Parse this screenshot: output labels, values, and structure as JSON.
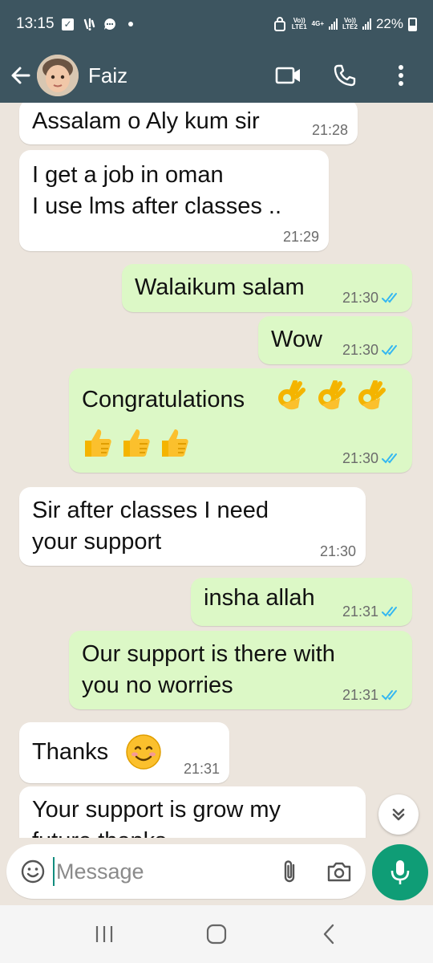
{
  "status": {
    "time": "13:15",
    "battery": "22%",
    "sim1_label": "Vo)) LTE1",
    "sim2_label": "Vo)) LTE2",
    "net": "4G+"
  },
  "header": {
    "contact_name": "Faiz",
    "icons": [
      "back-arrow-icon",
      "video-call-icon",
      "phone-icon",
      "more-icon"
    ]
  },
  "messages": [
    {
      "dir": "in",
      "text": "Assalam o Aly kum sir",
      "time": "21:28"
    },
    {
      "dir": "in",
      "text": "I get a job in oman\nI use lms after classes ..",
      "time": "21:29"
    },
    {
      "dir": "out",
      "text": "Walaikum salam",
      "time": "21:30",
      "read": true
    },
    {
      "dir": "out",
      "text": "Wow",
      "time": "21:30",
      "read": true
    },
    {
      "dir": "out",
      "text": "Congratulations",
      "time": "21:30",
      "read": true,
      "emojis_line1": [
        "ok-hand",
        "ok-hand",
        "ok-hand"
      ],
      "emojis_line2": [
        "thumbs-up",
        "thumbs-up",
        "thumbs-up"
      ]
    },
    {
      "dir": "in",
      "text": "Sir after classes I need\nyour support",
      "time": "21:30"
    },
    {
      "dir": "out",
      "text": "insha allah",
      "time": "21:31",
      "read": true
    },
    {
      "dir": "out",
      "text": "Our support is there with\nyou no worries",
      "time": "21:31",
      "read": true
    },
    {
      "dir": "in",
      "text": "Thanks",
      "time": "21:31",
      "emoji": "smiling-face"
    },
    {
      "dir": "in",
      "text": "Your support is grow my\nfuture thanks",
      "time": ""
    }
  ],
  "composer": {
    "placeholder": "Message",
    "icons": [
      "emoji-icon",
      "attach-icon",
      "camera-icon",
      "mic-icon"
    ]
  },
  "colors": {
    "header": "#3d5560",
    "chat_bg": "#ece5dd",
    "incoming": "#ffffff",
    "outgoing": "#dcf8c6",
    "accent": "#0f9d76",
    "read_tick": "#34b7f1"
  }
}
